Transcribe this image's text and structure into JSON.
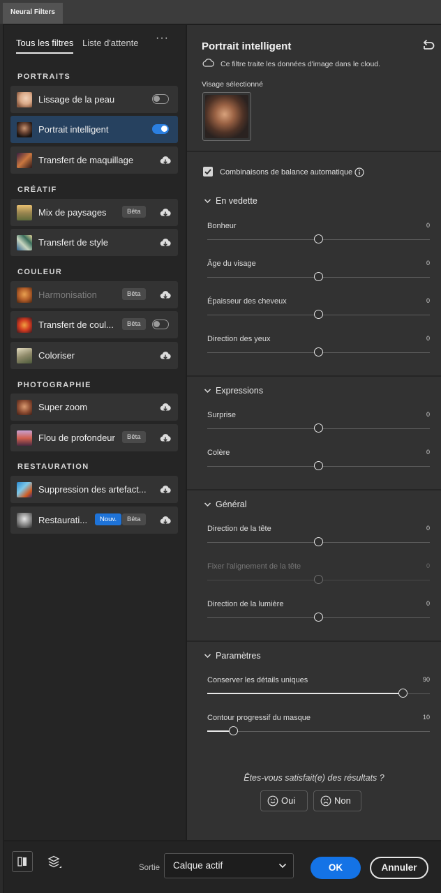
{
  "window_tab": "Neural Filters",
  "sidebar": {
    "tabs": [
      "Tous les filtres",
      "Liste d'attente"
    ],
    "more": "···",
    "sections": [
      {
        "title": "PORTRAITS",
        "items": [
          {
            "label": "Lissage de la peau",
            "control": "toggle-off",
            "icon": "face-smooth-thumbnail"
          },
          {
            "label": "Portrait intelligent",
            "control": "toggle-on",
            "active": true,
            "icon": "portrait-thumbnail"
          },
          {
            "label": "Transfert de maquillage",
            "control": "cloud",
            "icon": "makeup-thumbnail"
          }
        ]
      },
      {
        "title": "CRÉATIF",
        "items": [
          {
            "label": "Mix de paysages",
            "badge": "Bêta",
            "control": "cloud",
            "icon": "landscape-thumbnail"
          },
          {
            "label": "Transfert de style",
            "control": "cloud",
            "icon": "style-thumbnail"
          }
        ]
      },
      {
        "title": "COULEUR",
        "items": [
          {
            "label": "Harmonisation",
            "badge": "Bêta",
            "control": "cloud",
            "disabled": true,
            "icon": "harmonization-thumbnail"
          },
          {
            "label": "Transfert de coul...",
            "badge": "Bêta",
            "control": "toggle-off",
            "icon": "color-transfer-thumbnail"
          },
          {
            "label": "Coloriser",
            "control": "cloud",
            "icon": "colorize-thumbnail"
          }
        ]
      },
      {
        "title": "PHOTOGRAPHIE",
        "items": [
          {
            "label": "Super zoom",
            "control": "cloud",
            "icon": "superzoom-thumbnail"
          },
          {
            "label": "Flou de profondeur",
            "badge": "Bêta",
            "control": "cloud",
            "icon": "depth-blur-thumbnail"
          }
        ]
      },
      {
        "title": "RESTAURATION",
        "items": [
          {
            "label": "Suppression des artefact...",
            "control": "cloud",
            "icon": "artifact-thumbnail"
          },
          {
            "label": "Restaurati...",
            "badge_new": "Nouv.",
            "badge": "Bêta",
            "control": "cloud",
            "icon": "restoration-thumbnail"
          }
        ]
      }
    ]
  },
  "panel": {
    "title": "Portrait intelligent",
    "cloud_note": "Ce filtre traite les données d'image dans le cloud.",
    "face_label": "Visage sélectionné",
    "auto_balance": {
      "label": "Combinaisons de balance automatique",
      "checked": true
    },
    "groups": [
      {
        "title": "En vedette",
        "sliders": [
          {
            "label": "Bonheur",
            "value": 0
          },
          {
            "label": "Âge du visage",
            "value": 0
          },
          {
            "label": "Épaisseur des cheveux",
            "value": 0
          },
          {
            "label": "Direction des yeux",
            "value": 0
          }
        ]
      },
      {
        "title": "Expressions",
        "sliders": [
          {
            "label": "Surprise",
            "value": 0
          },
          {
            "label": "Colère",
            "value": 0
          }
        ]
      },
      {
        "title": "Général",
        "sliders": [
          {
            "label": "Direction de la tête",
            "value": 0
          },
          {
            "label": "Fixer l'alignement de la tête",
            "value": 0,
            "disabled": true
          },
          {
            "label": "Direction de la lumière",
            "value": 0
          }
        ]
      },
      {
        "title": "Paramètres",
        "sliders": [
          {
            "label": "Conserver les détails uniques",
            "value": 90,
            "min": 0,
            "max": 100
          },
          {
            "label": "Contour progressif du masque",
            "value": 10,
            "min": 0,
            "max": 100
          }
        ]
      }
    ],
    "feedback_question": "Êtes-vous satisfait(e) des résultats ?",
    "feedback_yes": "Oui",
    "feedback_no": "Non"
  },
  "footer": {
    "output_label": "Sortie",
    "output_value": "Calque actif",
    "ok": "OK",
    "cancel": "Annuler"
  },
  "colors": {
    "accent": "#1473e6",
    "active_item": "#26415f"
  }
}
